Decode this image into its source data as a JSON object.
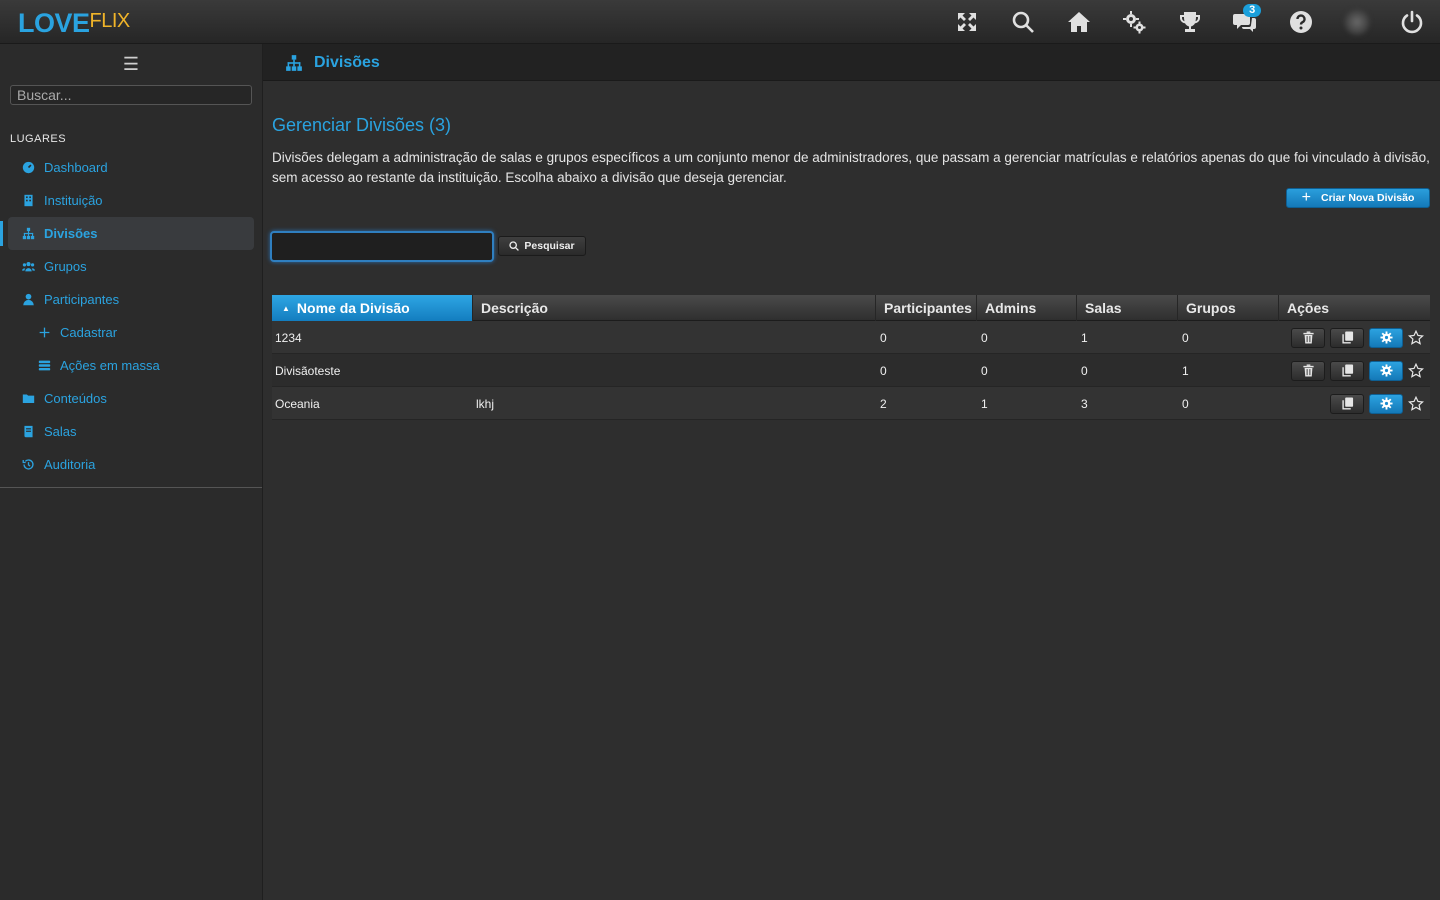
{
  "app": {
    "logo_love": "LOVE",
    "logo_flix": "FLIX"
  },
  "topbar": {
    "notifications_count": "3"
  },
  "sidebar": {
    "search_placeholder": "Buscar...",
    "section_title": "LUGARES",
    "items": [
      {
        "label": "Dashboard",
        "icon": "dashboard-icon"
      },
      {
        "label": "Instituição",
        "icon": "building-icon"
      },
      {
        "label": "Divisões",
        "icon": "sitemap-icon",
        "active": true
      },
      {
        "label": "Grupos",
        "icon": "users-icon"
      },
      {
        "label": "Participantes",
        "icon": "user-icon"
      },
      {
        "label": "Cadastrar",
        "icon": "plus-icon",
        "sub": true
      },
      {
        "label": "Ações em massa",
        "icon": "list-icon",
        "sub": true
      },
      {
        "label": "Conteúdos",
        "icon": "folder-icon"
      },
      {
        "label": "Salas",
        "icon": "book-icon"
      },
      {
        "label": "Auditoria",
        "icon": "history-icon"
      }
    ]
  },
  "page": {
    "header_title": "Divisões",
    "heading": "Gerenciar Divisões (3)",
    "description": "Divisões delegam a administração de salas e grupos específicos a um conjunto menor de administradores, que passam a gerenciar matrículas e relatórios apenas do que foi vinculado à divisão, sem acesso ao restante da instituição. Escolha abaixo a divisão que deseja gerenciar.",
    "create_button": "Criar Nova Divisão",
    "search_button": "Pesquisar",
    "filter_value": ""
  },
  "table": {
    "columns": [
      "Nome da Divisão",
      "Descrição",
      "Participantes",
      "Admins",
      "Salas",
      "Grupos",
      "Ações"
    ],
    "rows": [
      {
        "name": "1234",
        "description": "",
        "participants": "0",
        "admins": "0",
        "rooms": "1",
        "groups": "0",
        "deletable": true
      },
      {
        "name": "Divisãoteste",
        "description": "",
        "participants": "0",
        "admins": "0",
        "rooms": "0",
        "groups": "1",
        "deletable": true
      },
      {
        "name": "Oceania",
        "description": "lkhj",
        "participants": "2",
        "admins": "1",
        "rooms": "3",
        "groups": "0",
        "deletable": false
      }
    ]
  },
  "colors": {
    "accent": "#2aa3e0",
    "logo_secondary": "#f0b429",
    "background": "#2e2e2e"
  }
}
